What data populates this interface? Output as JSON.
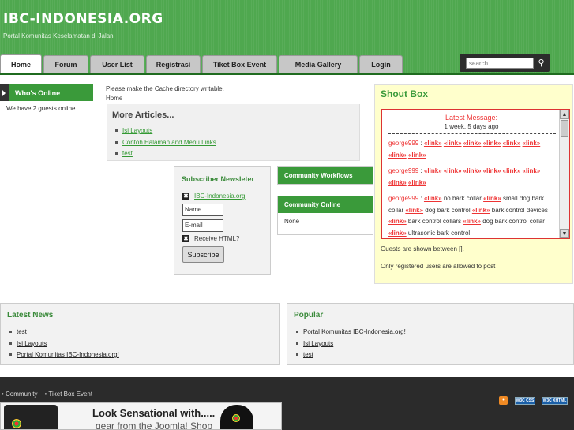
{
  "header": {
    "title": "IBC-INDONESIA.ORG",
    "slogan": "Portal Komunitas Keselamatan di Jalan",
    "tabs": [
      {
        "label": "Home",
        "active": true
      },
      {
        "label": "Forum"
      },
      {
        "label": "User List"
      },
      {
        "label": "Registrasi"
      },
      {
        "label": "Tiket Box Event"
      },
      {
        "label": "Media Gallery"
      },
      {
        "label": "Login"
      }
    ],
    "search_placeholder": "search..."
  },
  "left": {
    "whos_online_title": "Who's Online",
    "guests_text": "We have 2 guests online"
  },
  "center": {
    "cache_message": "Please make the Cache directory writable.",
    "breadcrumb": "Home",
    "more_articles": {
      "title": "More Articles...",
      "items": [
        "Isi Layouts",
        "Contoh Halaman and Menu Links",
        "test"
      ]
    },
    "subscriber": {
      "title": "Subscriber Newsleter",
      "list_link": "IBC-Indonesia.org",
      "name_placeholder": "Name",
      "email_placeholder": "E-mail",
      "html_label": "Receive HTML?",
      "subscribe_label": "Subscribe"
    },
    "community_workflows_title": "Community Workflows",
    "community_online_title": "Community Online",
    "community_online_text": "None"
  },
  "shoutbox": {
    "title": "Shout Box",
    "latest_label": "Latest Message:",
    "latest_time": "1 week, 5 days ago",
    "link_text": "«link»",
    "messages": [
      {
        "user": "george999",
        "text": ""
      },
      {
        "user": "george999",
        "text": ""
      },
      {
        "user": "george999",
        "text": "no bark collar · small dog bark collar · dog bark control · bark control devices · bark control collars · dog bark control collar · ultrasonic bark control"
      }
    ],
    "note1": "Guests are shown between [].",
    "note2": "Only registered users are allowed to post"
  },
  "latest_news": {
    "title": "Latest News",
    "items": [
      "test",
      "Isi Layouts",
      "Portal Komunitas IBC-Indonesia.org!"
    ]
  },
  "popular": {
    "title": "Popular",
    "items": [
      "Portal Komunitas IBC-Indonesia.org!",
      "Isi Layouts",
      "test"
    ]
  },
  "footer": {
    "links": [
      "Community",
      "Tiket Box Event"
    ],
    "css_badge": "W3C CSS",
    "xhtml_badge": "W3C XHTML",
    "banner_line1": "Look Sensational with.....",
    "banner_line2": "gear from the Joomla! Shop"
  },
  "colors": {
    "header_green": "#4fa84f",
    "module_green": "#3a9a3a",
    "link_green": "#339933",
    "shout_red": "#e33333",
    "shout_bg": "#ffffcc",
    "footer_dark": "#2b2b2b"
  }
}
